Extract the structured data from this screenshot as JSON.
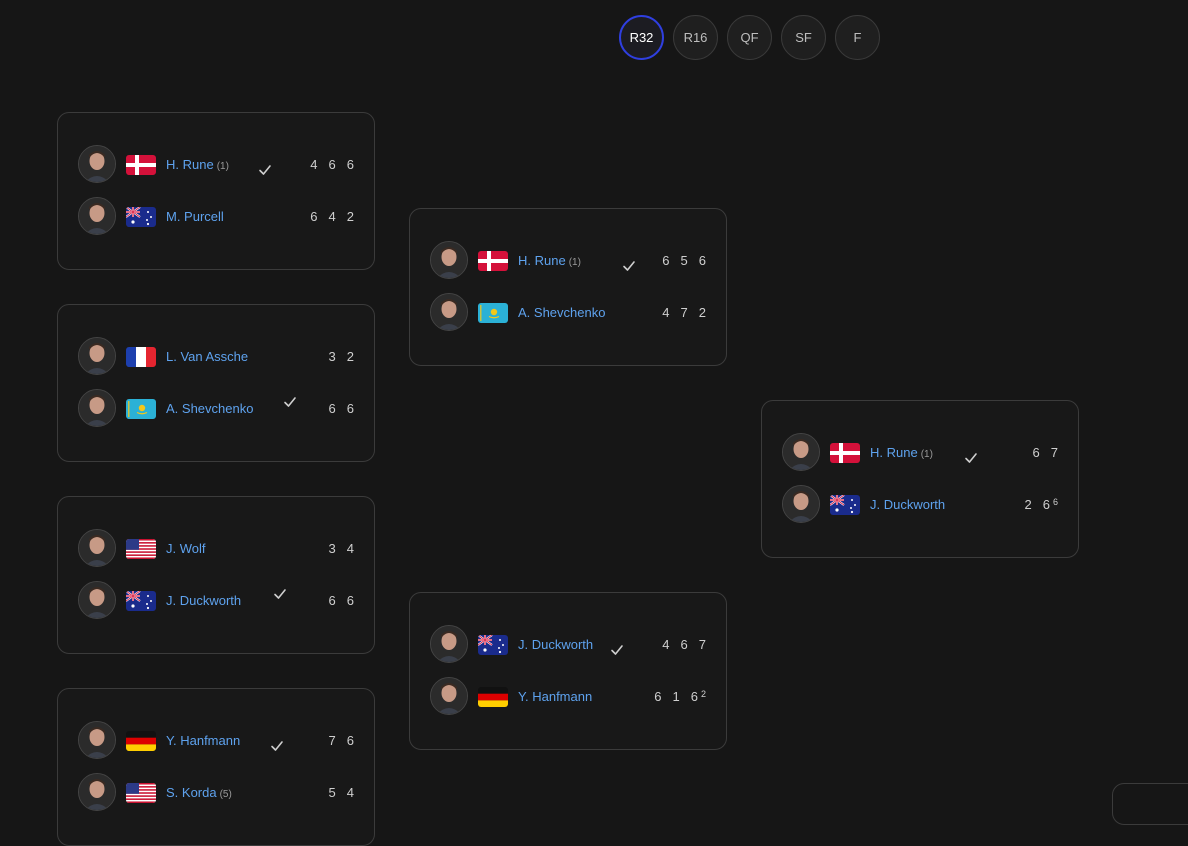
{
  "rounds": [
    {
      "label": "R32",
      "active": true
    },
    {
      "label": "R16",
      "active": false
    },
    {
      "label": "QF",
      "active": false
    },
    {
      "label": "SF",
      "active": false
    },
    {
      "label": "F",
      "active": false
    }
  ],
  "matches": [
    {
      "id": "m1",
      "players": [
        {
          "name": "H. Rune",
          "seed": "(1)",
          "flag": "DEN",
          "winner": true,
          "scores": [
            "4",
            "6",
            "6"
          ]
        },
        {
          "name": "M. Purcell",
          "seed": "",
          "flag": "AUS",
          "winner": false,
          "scores": [
            "6",
            "4",
            "2"
          ]
        }
      ]
    },
    {
      "id": "m2",
      "players": [
        {
          "name": "L. Van Assche",
          "seed": "",
          "flag": "FRA",
          "winner": false,
          "scores": [
            "3",
            "2"
          ]
        },
        {
          "name": "A. Shevchenko",
          "seed": "",
          "flag": "KAZ",
          "winner": true,
          "scores": [
            "6",
            "6"
          ]
        }
      ]
    },
    {
      "id": "m3",
      "players": [
        {
          "name": "J. Wolf",
          "seed": "",
          "flag": "USA",
          "winner": false,
          "scores": [
            "3",
            "4"
          ]
        },
        {
          "name": "J. Duckworth",
          "seed": "",
          "flag": "AUS",
          "winner": true,
          "scores": [
            "6",
            "6"
          ]
        }
      ]
    },
    {
      "id": "m4",
      "players": [
        {
          "name": "Y. Hanfmann",
          "seed": "",
          "flag": "GER",
          "winner": true,
          "scores": [
            "7",
            "6"
          ]
        },
        {
          "name": "S. Korda",
          "seed": "(5)",
          "flag": "USA",
          "winner": false,
          "scores": [
            "5",
            "4"
          ]
        }
      ]
    },
    {
      "id": "m5",
      "players": [
        {
          "name": "H. Rune",
          "seed": "(1)",
          "flag": "DEN",
          "winner": true,
          "scores": [
            "6",
            "5",
            "6"
          ]
        },
        {
          "name": "A. Shevchenko",
          "seed": "",
          "flag": "KAZ",
          "winner": false,
          "scores": [
            "4",
            "7",
            "2"
          ]
        }
      ]
    },
    {
      "id": "m6",
      "players": [
        {
          "name": "J. Duckworth",
          "seed": "",
          "flag": "AUS",
          "winner": true,
          "scores": [
            "4",
            "6",
            "7"
          ]
        },
        {
          "name": "Y. Hanfmann",
          "seed": "",
          "flag": "GER",
          "winner": false,
          "scores": [
            "6",
            "1",
            "6"
          ],
          "tiebreak": [
            "",
            "",
            "2"
          ]
        }
      ]
    },
    {
      "id": "m7",
      "players": [
        {
          "name": "H. Rune",
          "seed": "(1)",
          "flag": "DEN",
          "winner": true,
          "scores": [
            "6",
            "7"
          ]
        },
        {
          "name": "J. Duckworth",
          "seed": "",
          "flag": "AUS",
          "winner": false,
          "scores": [
            "2",
            "6"
          ],
          "tiebreak": [
            "",
            "6"
          ]
        }
      ]
    }
  ],
  "colors": {
    "accent": "#2f3fe0",
    "link": "#5ea2ee",
    "border": "#3b3b3b",
    "background": "#161616"
  }
}
